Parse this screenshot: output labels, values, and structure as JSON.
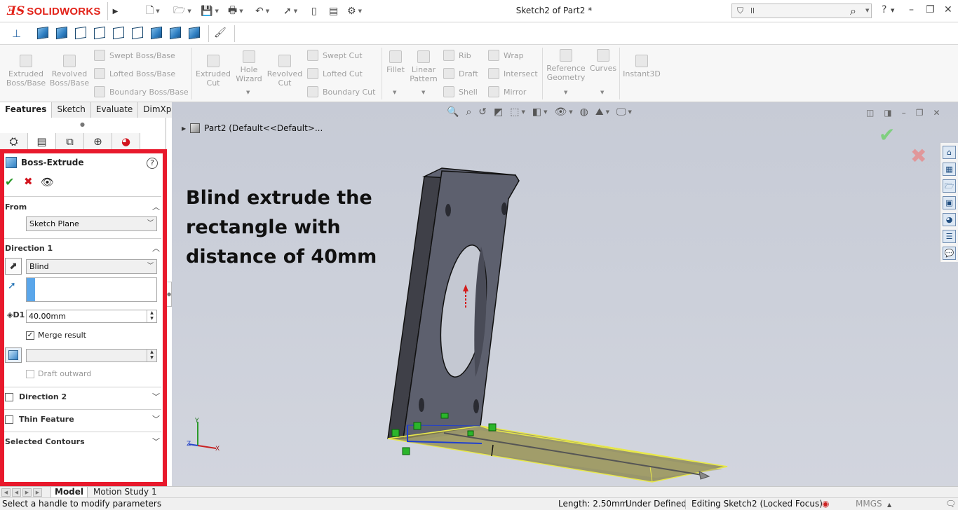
{
  "app": {
    "brand": "SOLIDWORKS",
    "document_title": "Sketch2 of Part2 *",
    "search_text": "ll"
  },
  "command_manager": {
    "col1": [
      {
        "label1": "Extruded",
        "label2": "Boss/Base"
      },
      {
        "label1": "Revolved",
        "label2": "Boss/Base"
      }
    ],
    "rows_boss": [
      "Swept Boss/Base",
      "Lofted Boss/Base",
      "Boundary Boss/Base"
    ],
    "col2": [
      {
        "label1": "Extruded",
        "label2": "Cut"
      },
      {
        "label1": "Hole",
        "label2": "Wizard"
      },
      {
        "label1": "Revolved",
        "label2": "Cut"
      }
    ],
    "rows_cut": [
      "Swept Cut",
      "Lofted Cut",
      "Boundary Cut"
    ],
    "fillet": "Fillet",
    "linear_pattern": {
      "label1": "Linear",
      "label2": "Pattern"
    },
    "rows_feat1": [
      "Rib",
      "Draft",
      "Shell"
    ],
    "rows_feat2": [
      "Wrap",
      "Intersect",
      "Mirror"
    ],
    "ref_geometry": {
      "label1": "Reference",
      "label2": "Geometry"
    },
    "curves": "Curves",
    "instant3d": "Instant3D"
  },
  "tabs": [
    "Features",
    "Sketch",
    "Evaluate",
    "DimXpert"
  ],
  "property_manager": {
    "title": "Boss-Extrude",
    "from_title": "From",
    "from_value": "Sketch Plane",
    "direction1_title": "Direction 1",
    "end_condition": "Blind",
    "depth": "40.00mm",
    "merge_result": "Merge result",
    "draft_outward": "Draft outward",
    "direction2_title": "Direction 2",
    "thin_feature": "Thin Feature",
    "selected_contours": "Selected Contours"
  },
  "viewport": {
    "tree_node": "Part2  (Default<<Default>...",
    "annotation": "Blind extrude the rectangle with distance of 40mm"
  },
  "bottom_tabs": [
    "Model",
    "Motion Study 1"
  ],
  "status": {
    "message": "Select a handle to modify parameters",
    "length": "Length: 2.50mm",
    "state": "Under Defined",
    "editing": "Editing Sketch2 (Locked Focus)",
    "units": "MMGS"
  },
  "colors": {
    "brand_red": "#e2231a",
    "highlight_red": "#e8192c",
    "confirm_green": "#2a9a2a",
    "selection_blue": "#5aa6ea",
    "preview_yellow": "#e8e84a"
  }
}
